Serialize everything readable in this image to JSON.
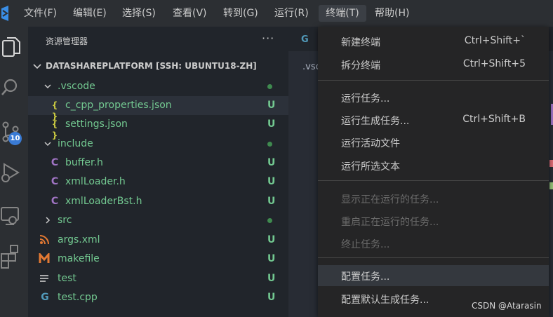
{
  "menubar": {
    "items": [
      "文件(F)",
      "编辑(E)",
      "选择(S)",
      "查看(V)",
      "转到(G)",
      "运行(R)",
      "终端(T)",
      "帮助(H)"
    ],
    "active": "终端(T)"
  },
  "activity_bar": {
    "icons": [
      "explorer-icon",
      "search-icon",
      "source-control-icon",
      "run-debug-icon",
      "remote-explorer-icon",
      "extensions-icon"
    ],
    "source_control_badge": "10"
  },
  "explorer": {
    "title": "资源管理器",
    "more_actions": "···",
    "root": "DATASHAREPLATFORM [SSH: UBUNTU18-ZH]",
    "tree": [
      {
        "label": ".vscode",
        "type": "folder",
        "expanded": true,
        "status": "dot"
      },
      {
        "label": "c_cpp_properties.json",
        "type": "json",
        "status": "U",
        "selected": true
      },
      {
        "label": "settings.json",
        "type": "json",
        "status": "U"
      },
      {
        "label": "include",
        "type": "folder",
        "expanded": true,
        "status": "dot"
      },
      {
        "label": "buffer.h",
        "type": "c-header",
        "status": "U"
      },
      {
        "label": "xmlLoader.h",
        "type": "c-header",
        "status": "U"
      },
      {
        "label": "xmlLoaderBst.h",
        "type": "c-header",
        "status": "U"
      },
      {
        "label": "src",
        "type": "folder",
        "expanded": false,
        "status": "dot"
      },
      {
        "label": "args.xml",
        "type": "xml",
        "status": "U"
      },
      {
        "label": "makefile",
        "type": "makefile",
        "status": "U"
      },
      {
        "label": "test",
        "type": "text",
        "status": "U"
      },
      {
        "label": "test.cpp",
        "type": "cpp",
        "status": "U"
      }
    ],
    "icon_glyphs": {
      "json": "{ }",
      "c-header": "C",
      "cpp": "G"
    }
  },
  "editor": {
    "tab_fragment": ".vsc",
    "breadcrumb_fragment": "G"
  },
  "terminal_menu": {
    "groups": [
      [
        {
          "label": "新建终端",
          "shortcut": "Ctrl+Shift+`"
        },
        {
          "label": "拆分终端",
          "shortcut": "Ctrl+Shift+5"
        }
      ],
      [
        {
          "label": "运行任务...",
          "shortcut": ""
        },
        {
          "label": "运行生成任务...",
          "shortcut": "Ctrl+Shift+B"
        },
        {
          "label": "运行活动文件",
          "shortcut": ""
        },
        {
          "label": "运行所选文本",
          "shortcut": ""
        }
      ],
      [
        {
          "label": "显示正在运行的任务...",
          "shortcut": "",
          "disabled": true
        },
        {
          "label": "重启正在运行的任务...",
          "shortcut": "",
          "disabled": true
        },
        {
          "label": "终止任务...",
          "shortcut": "",
          "disabled": true
        }
      ],
      [
        {
          "label": "配置任务...",
          "shortcut": "",
          "hover": true
        },
        {
          "label": "配置默认生成任务...",
          "shortcut": ""
        }
      ]
    ]
  },
  "watermark": "CSDN @Atarasin",
  "colors": {
    "untracked": "#73c991",
    "json_icon": "#cbcb41",
    "c_icon": "#a074c4",
    "xml_icon": "#e37933",
    "makefile_icon": "#e37933",
    "cpp_icon": "#519aba",
    "badge": "#3a7bd5"
  }
}
